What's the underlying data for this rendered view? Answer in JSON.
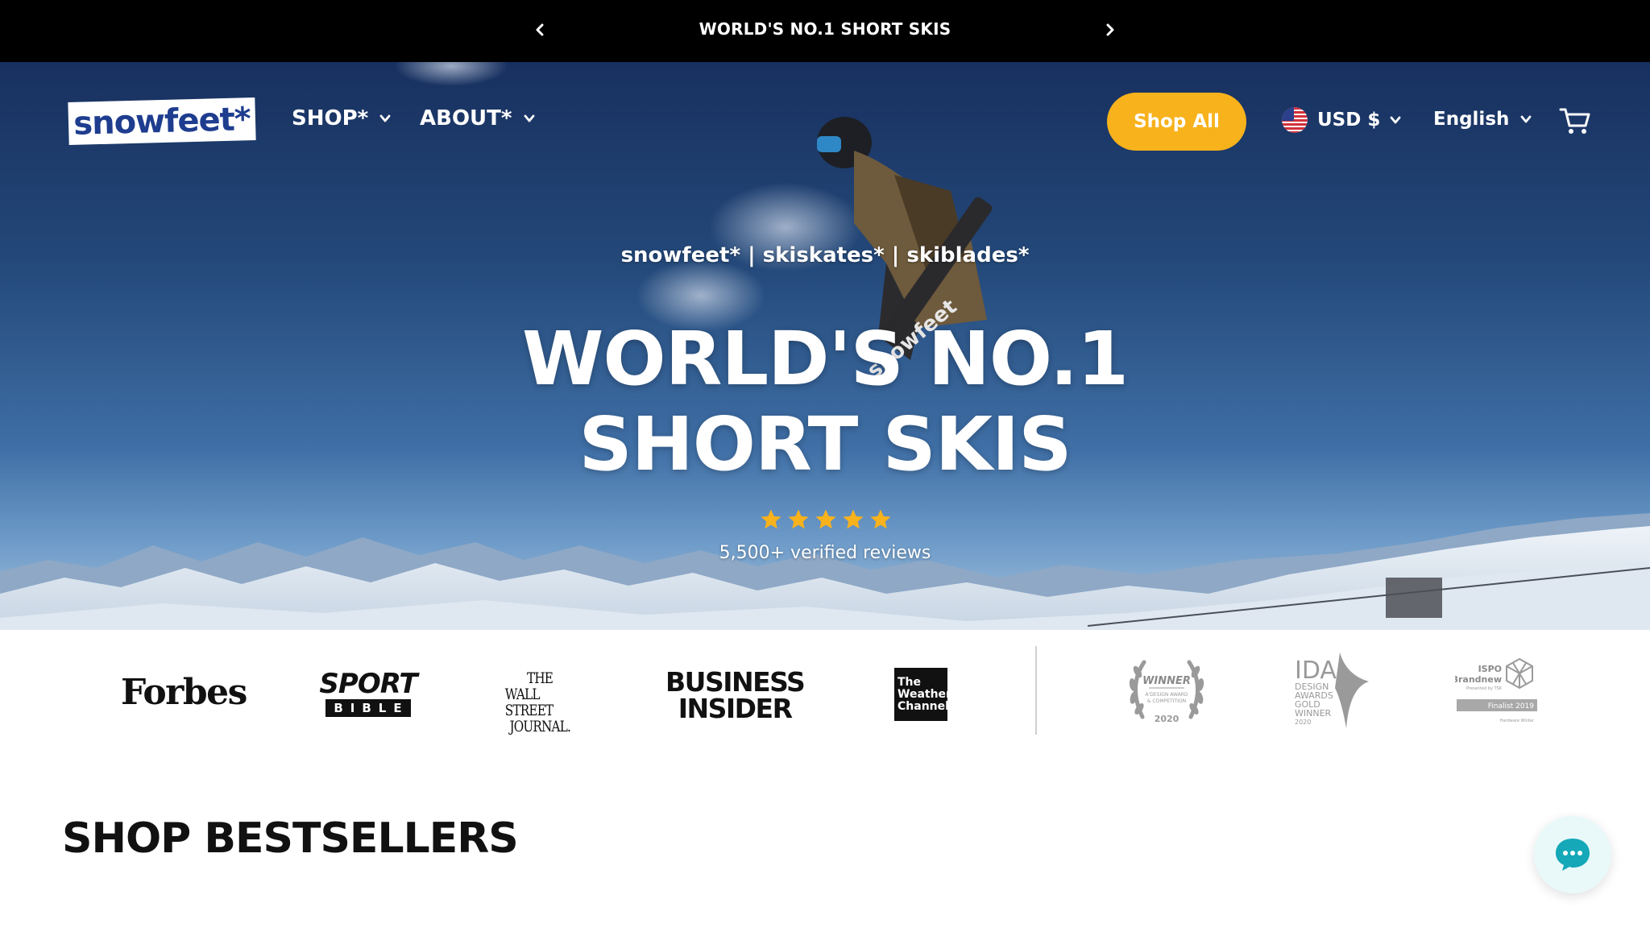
{
  "announcement": {
    "text": "WORLD'S NO.1 SHORT SKIS",
    "prev_icon": "chevron-left-icon",
    "next_icon": "chevron-right-icon"
  },
  "header": {
    "logo_text": "snowfeet*",
    "nav": [
      {
        "label": "SHOP*"
      },
      {
        "label": "ABOUT*"
      }
    ],
    "shop_all_label": "Shop All",
    "currency_label": "USD $",
    "language_label": "English",
    "cart_icon": "cart-icon"
  },
  "hero": {
    "subtitle": "snowfeet* | skiskates* | skiblades*",
    "title_line1": "WORLD'S NO.1",
    "title_line2": "SHORT SKIS",
    "rating_stars": 5,
    "reviews_text": "5,500+ verified reviews",
    "ski_print": "snowfeet"
  },
  "press": {
    "forbes": "Forbes",
    "sport_bible_1": "SPORT",
    "sport_bible_2": "BIBLE",
    "wsj_1": "THE",
    "wsj_2": "WALL STREET",
    "wsj_3": "JOURNAL.",
    "business_insider_1": "BUSINESS",
    "business_insider_2": "INSIDER",
    "weather_1": "The",
    "weather_2": "Weather",
    "weather_3": "Channel",
    "award1_1": "WINNER",
    "award1_2": "A'DESIGN AWARD",
    "award1_3": "& COMPETITION",
    "award1_4": "2020",
    "award2_1": "IDA",
    "award2_2": "DESIGN",
    "award2_3": "AWARDS",
    "award2_4": "GOLD",
    "award2_5": "WINNER",
    "award2_6": "2020",
    "award3_1": "ISPO",
    "award3_2": "Brandnew",
    "award3_3": "Presented by TSK",
    "award3_4": "Finalist 2019",
    "award3_5": "Hardware Winter"
  },
  "section": {
    "title": "SHOP BESTSELLERS"
  },
  "colors": {
    "accent_yellow": "#f8b21c",
    "announcement_bg": "#000000",
    "chat_icon": "#14a8b8"
  }
}
